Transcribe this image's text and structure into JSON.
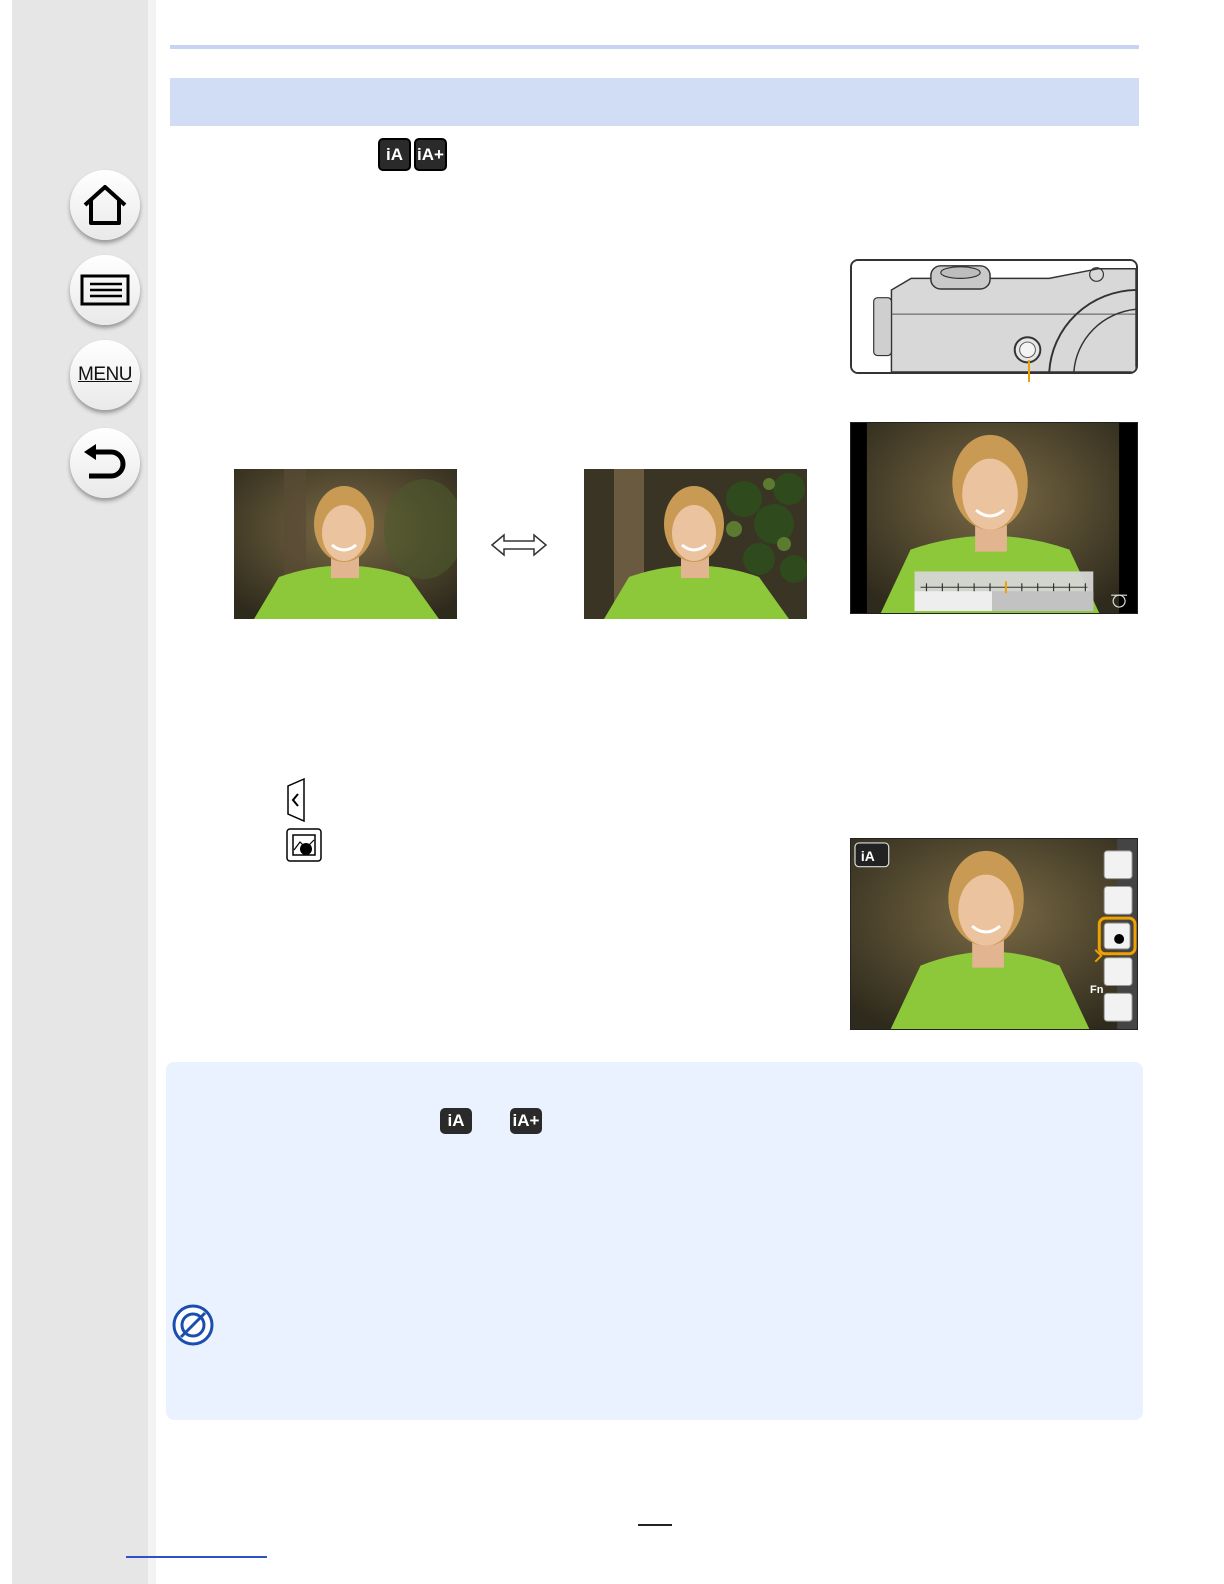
{
  "sidebar": {
    "items": [
      {
        "name": "home-icon"
      },
      {
        "name": "list-icon"
      },
      {
        "label": "MENU"
      },
      {
        "name": "back-icon"
      }
    ]
  },
  "header": {
    "mode_icons": [
      "iA",
      "iA+"
    ]
  },
  "callout_color": "#f0a000",
  "notes": {
    "mode_icons": [
      "iA",
      "iA+"
    ]
  },
  "touch_menu": {
    "icons": [
      "zoom-icon",
      "touch-shutter-icon",
      "defocus-icon",
      "touch-ae-icon",
      "peaking-icon"
    ],
    "fn_label": "Fn"
  }
}
